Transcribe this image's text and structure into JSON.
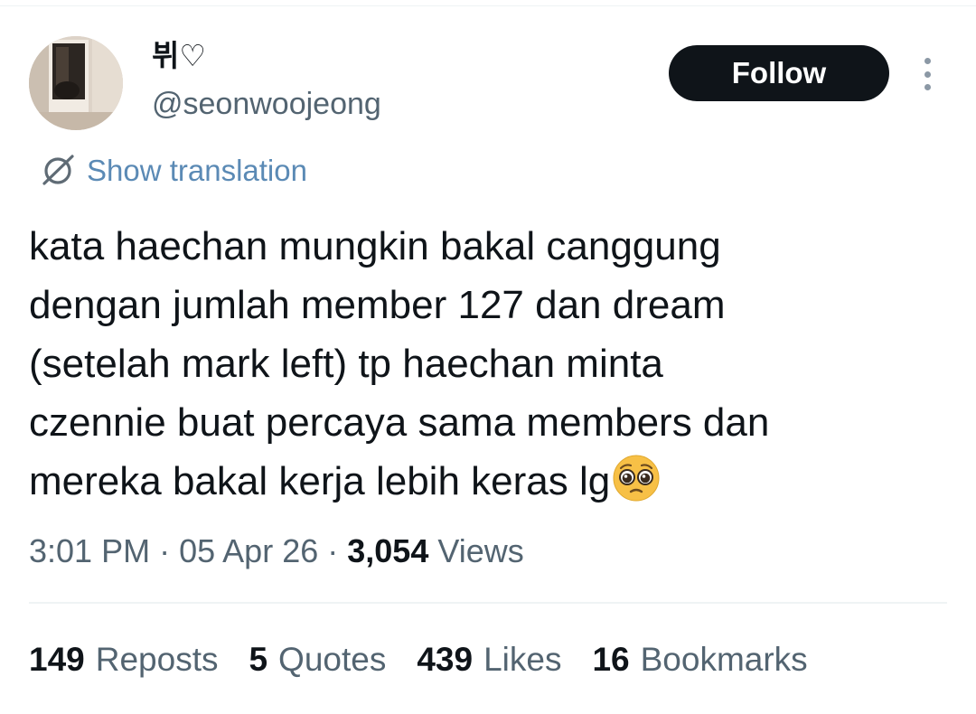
{
  "author": {
    "display_name": "뷔♡",
    "handle": "@seonwoojeong"
  },
  "follow_label": "Follow",
  "translation_label": "Show translation",
  "tweet_lines": [
    "kata haechan mungkin bakal canggung",
    "dengan jumlah member 127 dan dream",
    "(setelah mark left) tp haechan minta",
    "czennie buat percaya sama members dan",
    "mereka bakal kerja lebih keras lg"
  ],
  "emoji": "pleading-face",
  "meta": {
    "time": "3:01 PM",
    "date": "05 Apr 26",
    "separator": "·",
    "views_count": "3,054",
    "views_label": "Views"
  },
  "stats": {
    "reposts_count": "149",
    "reposts_label": "Reposts",
    "quotes_count": "5",
    "quotes_label": "Quotes",
    "likes_count": "439",
    "likes_label": "Likes",
    "bookmarks_count": "16",
    "bookmarks_label": "Bookmarks"
  },
  "colors": {
    "text": "#0f1419",
    "secondary": "#536471",
    "link": "#5b8ab5",
    "button_bg": "#0f1419"
  },
  "icons": [
    "avatar-photo",
    "more-vertical-icon",
    "globe-icon",
    "pleading-face-emoji"
  ]
}
